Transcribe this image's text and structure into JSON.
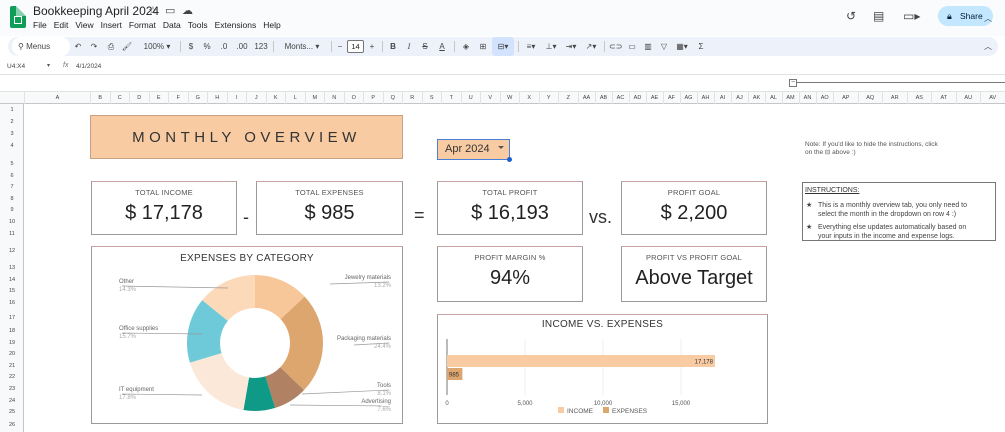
{
  "app": {
    "doc_title": "Bookkeeping April 2024",
    "menu": [
      "File",
      "Edit",
      "View",
      "Insert",
      "Format",
      "Data",
      "Tools",
      "Extensions",
      "Help"
    ],
    "share_label": "Share",
    "brand_color": "#0f9d58"
  },
  "toolbar": {
    "search_label": "Menus",
    "zoom": "100%",
    "currency": "$",
    "percent": "%",
    "dec_less": ".0",
    "dec_more": ".00",
    "number_format": "123",
    "font": "Monts...",
    "font_size": "14",
    "bold": "B",
    "italic": "I",
    "strike": "S",
    "text_color": "A"
  },
  "formula_bar": {
    "name_box": "U4:X4",
    "fx": "fx",
    "value": "4/1/2024"
  },
  "columns": [
    "A",
    "B",
    "C",
    "D",
    "E",
    "F",
    "G",
    "H",
    "I",
    "J",
    "K",
    "L",
    "M",
    "N",
    "O",
    "P",
    "Q",
    "R",
    "S",
    "T",
    "U",
    "V",
    "W",
    "X",
    "Y",
    "Z",
    "AA",
    "AB",
    "AC",
    "AD",
    "AE",
    "AF",
    "AG",
    "AH",
    "AI",
    "AJ",
    "AK",
    "AL",
    "AM",
    "AN",
    "AO",
    "AP",
    "AQ",
    "AR",
    "AS",
    "AT",
    "AU",
    "AV",
    "AW"
  ],
  "rows": [
    "1",
    "2",
    "3",
    "4",
    "5",
    "6",
    "7",
    "8",
    "9",
    "10",
    "11",
    "12",
    "13",
    "14",
    "15",
    "16",
    "17",
    "18",
    "19",
    "20",
    "21",
    "22",
    "23",
    "24",
    "25",
    "26"
  ],
  "sheet": {
    "title": "MONTHLY OVERVIEW",
    "month": "Apr 2024",
    "accent_color": "#f8cba3",
    "total_income_label": "TOTAL INCOME",
    "total_income": "$ 17,178",
    "minus": "-",
    "total_expenses_label": "TOTAL EXPENSES",
    "total_expenses": "$ 985",
    "equals": "=",
    "total_profit_label": "TOTAL PROFIT",
    "total_profit": "$ 16,193",
    "vs": "vs.",
    "profit_goal_label": "PROFIT GOAL",
    "profit_goal": "$ 2,200",
    "profit_margin_label": "PROFIT MARGIN %",
    "profit_margin": "94%",
    "profit_vs_goal_label": "PROFIT VS PROFIT GOAL",
    "profit_vs_goal": "Above Target",
    "note_line1": "Note: If you'd like to hide the instructions, click",
    "note_line2": "on the ⊟ above :)",
    "instructions_heading": "INSTRUCTIONS:",
    "instruction_1a": "This is a monthly overview tab, you only need to",
    "instruction_1b": "select the month in the dropdown on row 4 :)",
    "instruction_2a": "Everything else updates automatically based on",
    "instruction_2b": "your inputs in the income and expense logs."
  },
  "chart_data": [
    {
      "type": "pie",
      "title": "EXPENSES BY CATEGORY",
      "donut": true,
      "slices": [
        {
          "name": "Jewelry materials",
          "label": "13.2%",
          "value": 13.2,
          "color": "#f7c79a"
        },
        {
          "name": "Packaging materials",
          "label": "24.4%",
          "value": 24.4,
          "color": "#dda66f"
        },
        {
          "name": "Tools",
          "label": "8.1%",
          "value": 8.1,
          "color": "#b08163"
        },
        {
          "name": "Advertising",
          "label": "7.6%",
          "value": 7.6,
          "color": "#0f9a87"
        },
        {
          "name": "IT equipment",
          "label": "17.8%",
          "value": 17.8,
          "color": "#fbe8d8"
        },
        {
          "name": "Office supplies",
          "label": "15.7%",
          "value": 15.7,
          "color": "#6ecad8"
        },
        {
          "name": "Other",
          "label": "14.3%",
          "value": 14.3,
          "color": "#fbd9b9"
        }
      ]
    },
    {
      "type": "bar",
      "orientation": "horizontal",
      "title": "INCOME VS. EXPENSES",
      "series": [
        {
          "name": "INCOME",
          "value": 17178,
          "label": "17,178",
          "color": "#f8cba3"
        },
        {
          "name": "EXPENSES",
          "value": 985,
          "label": "985",
          "color": "#dda66f"
        }
      ],
      "xlim": [
        0,
        20000
      ],
      "xticks": [
        "0",
        "5,000",
        "10,000",
        "15,000"
      ],
      "xtick_values": [
        0,
        5000,
        10000,
        15000
      ],
      "legend": "bottom",
      "grid": true
    }
  ]
}
